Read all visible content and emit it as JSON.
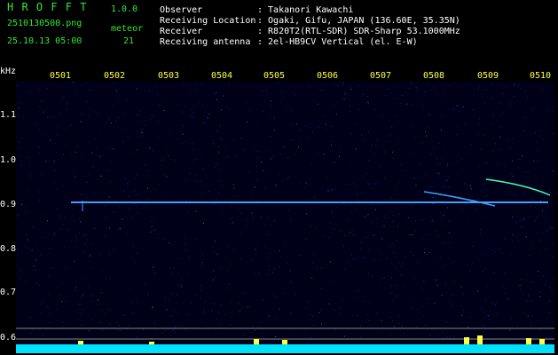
{
  "header": {
    "app_title": "H R O F F T",
    "app_version": "1.0.0",
    "filename": "2510130500.png",
    "timestamp": "25.10.13 05:00",
    "meteor_label": "meteor",
    "meteor_count": "21",
    "observer_label": "Observer",
    "observer_value": ": Takanori Kawachi",
    "location_label": "Receiving Location",
    "location_value": ": Ogaki, Gifu, JAPAN (136.60E, 35.35N)",
    "receiver_label": "Receiver",
    "receiver_value": ": R820T2(RTL-SDR) SDR-Sharp 53.1000MHz",
    "antenna_label": "Receiving antenna",
    "antenna_value": ": 2el-HB9CV Vertical (el. E-W)"
  },
  "axis": {
    "unit": "kHz",
    "freq_ticks": [
      "1.1",
      "1.0",
      "0.9",
      "0.8",
      "0.7",
      "0.6"
    ],
    "time_ticks": [
      "0501",
      "0502",
      "0503",
      "0504",
      "0505",
      "0506",
      "0507",
      "0508",
      "0509",
      "0510"
    ]
  },
  "colors": {
    "background": "#000000",
    "header_green": "#30e830",
    "time_label_yellow": "#ffff40",
    "signal_line": "#40a0ff",
    "noise_floor": "#00e0ff",
    "burst": "#ffff40"
  }
}
